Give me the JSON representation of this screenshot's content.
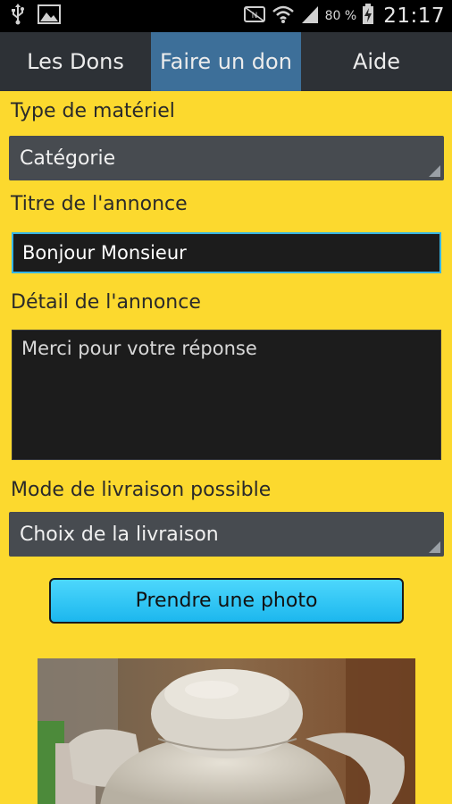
{
  "status_bar": {
    "battery_percent": "80 %",
    "time": "21:17",
    "icons": [
      "usb-icon",
      "image-notification-icon",
      "nfc-icon",
      "wifi-icon",
      "signal-icon",
      "battery-charging-icon"
    ]
  },
  "tabs": [
    {
      "label": "Les Dons",
      "active": false
    },
    {
      "label": "Faire un don",
      "active": true
    },
    {
      "label": "Aide",
      "active": false
    }
  ],
  "form": {
    "type_label": "Type de matériel",
    "type_value": "Catégorie",
    "title_label": "Titre de l'annonce",
    "title_value": "Bonjour Monsieur",
    "detail_label": "Détail de l'annonce",
    "detail_value": "Merci pour votre réponse",
    "delivery_label": "Mode de livraison possible",
    "delivery_value": "Choix de la livraison",
    "photo_button": "Prendre une photo"
  },
  "colors": {
    "background": "#fcd92e",
    "tab_bar": "#2d3136",
    "tab_active": "#3d6f99",
    "spinner": "#474b50",
    "field": "#1c1c1c",
    "field_focus_border": "#35b5e5",
    "button": "#2ec8f6"
  }
}
